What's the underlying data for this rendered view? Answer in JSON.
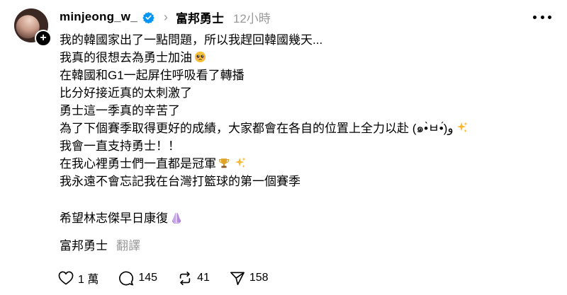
{
  "post": {
    "username": "minjeong_w_",
    "community": "富邦勇士",
    "time": "12小時",
    "lines": [
      "我的韓國家出了一點問題，所以我趕回韓國幾天...",
      "我真的很想去為勇士加油",
      "在韓國和G1一起屏住呼吸看了轉播",
      "比分好接近真的太刺激了",
      "勇士這一季真的辛苦了",
      "為了下個賽季取得更好的成績，大家都會在各自的位置上全力以赴 ‎(๑•̀ㅂ•́)و",
      "我會一直支持勇士！！",
      "在我心裡勇士們一直都是冠軍",
      "我永遠不會忘記我在台灣打籃球的第一個賽季"
    ],
    "wish_line": "希望林志傑早日康復",
    "tag": "富邦勇士",
    "translate_label": "翻譯"
  },
  "actions": {
    "likes": "1 萬",
    "comments": "145",
    "reposts": "41",
    "shares": "158"
  },
  "icons": {
    "verified": "verified-badge-icon",
    "more": "more-options-icon",
    "like": "heart-icon",
    "comment": "comment-bubble-icon",
    "repost": "repost-icon",
    "share": "send-icon"
  },
  "colors": {
    "verified_blue": "#0095F6",
    "muted_gray": "#999999"
  }
}
